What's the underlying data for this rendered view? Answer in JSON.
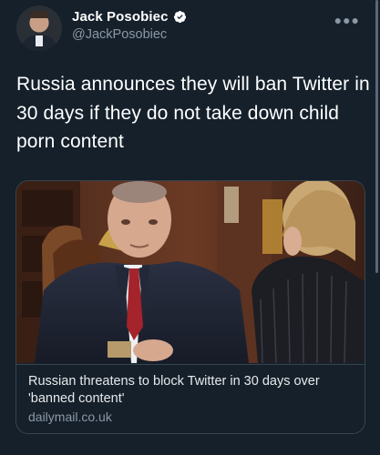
{
  "tweet": {
    "author": {
      "display_name": "Jack Posobiec",
      "handle": "@JackPosobiec",
      "verified_icon": "verified-badge-icon",
      "avatar_icon": "profile-avatar"
    },
    "more_icon": "more-options-icon",
    "text": "Russia announces they will ban Twitter in 30 days if they do not take down child porn content",
    "link_card": {
      "title": "Russian threatens to block Twitter in 30 days over 'banned content'",
      "domain": "dailymail.co.uk"
    }
  },
  "colors": {
    "background": "#15202b",
    "text_primary": "#ffffff",
    "text_secondary": "#8b98a5",
    "border": "#38444d",
    "verified": "#ffffff"
  }
}
